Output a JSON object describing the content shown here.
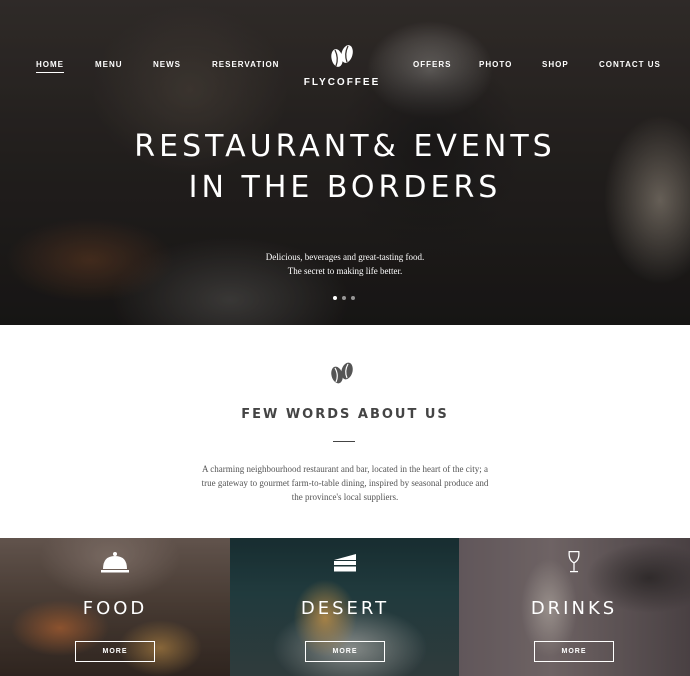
{
  "nav": {
    "left": [
      "HOME",
      "MENU",
      "NEWS",
      "RESERVATION"
    ],
    "right": [
      "OFFERS",
      "PHOTO",
      "SHOP",
      "CONTACT US"
    ],
    "active": "HOME"
  },
  "logo": {
    "text": "FLYCOFFEE",
    "icon": "coffee-beans-icon"
  },
  "hero": {
    "title_line1": "RESTAURANT& EVENTS",
    "title_line2": "IN THE BORDERS",
    "sub_line1": "Delicious, beverages and great-tasting food.",
    "sub_line2": "The secret to making life better.",
    "slides": 3,
    "active_slide": 1
  },
  "about": {
    "icon": "coffee-beans-icon",
    "title": "FEW WORDS ABOUT US",
    "text_line1": "A charming neighbourhood restaurant and bar, located in the heart of the city; a",
    "text_line2": "true gateway to gourmet farm-to-table dining, inspired by seasonal produce and",
    "text_line3": "the province's local suppliers."
  },
  "cards": [
    {
      "title": "FOOD",
      "button": "MORE",
      "icon": "cloche-icon"
    },
    {
      "title": "DESERT",
      "button": "MORE",
      "icon": "cake-slice-icon"
    },
    {
      "title": "DRINKS",
      "button": "MORE",
      "icon": "wine-glass-icon"
    }
  ],
  "colors": {
    "text_dark": "#444444",
    "text_body": "#555555",
    "white": "#ffffff"
  }
}
